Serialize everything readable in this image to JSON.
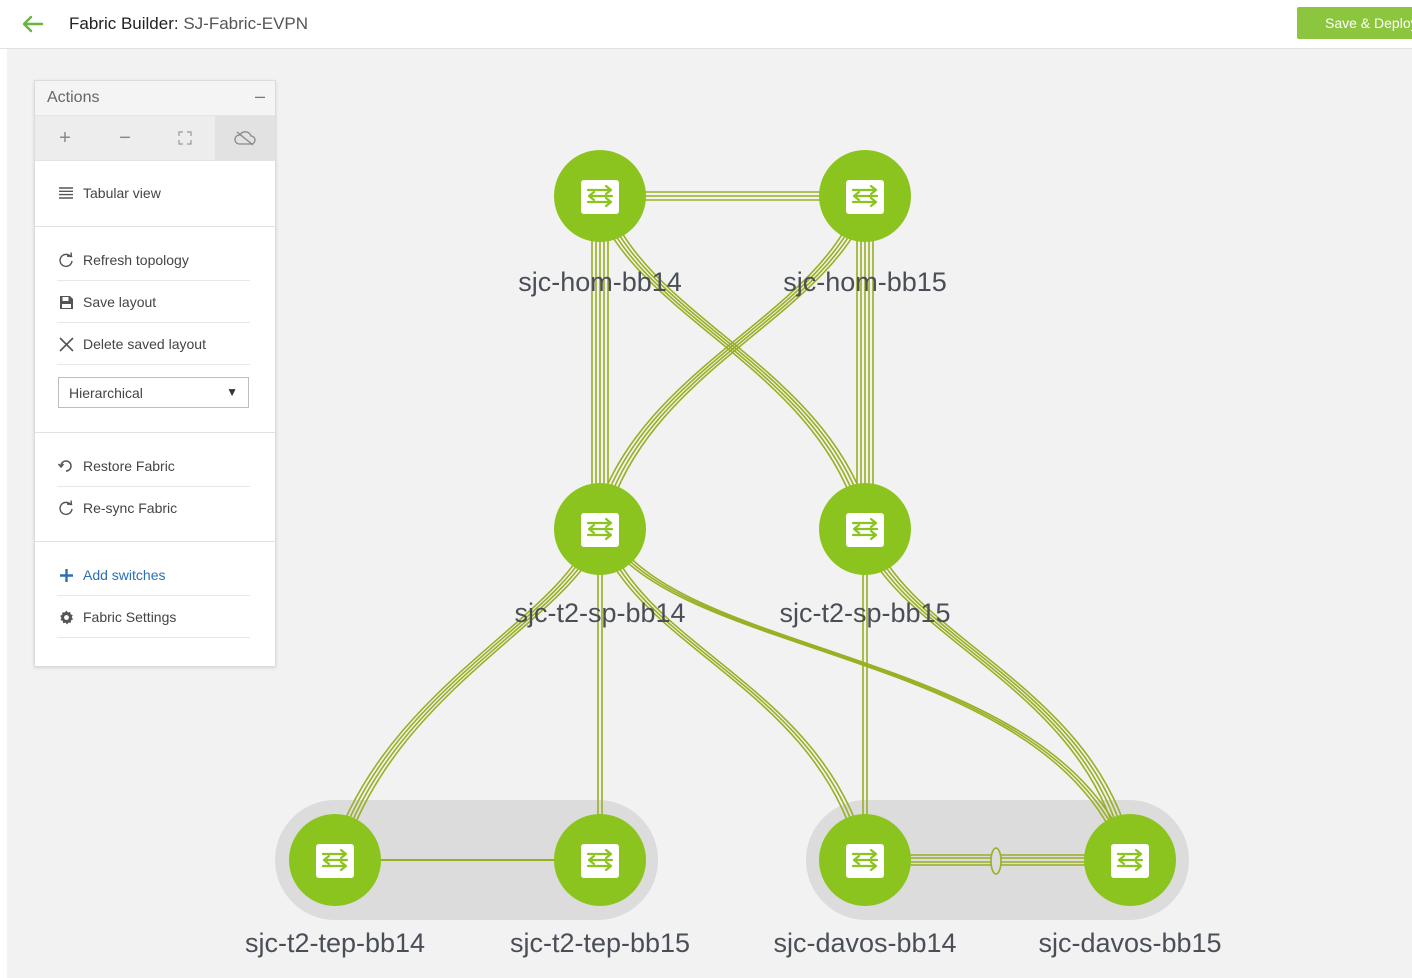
{
  "header": {
    "title_prefix": "Fabric Builder:",
    "title_name": "SJ-Fabric-EVPN",
    "save_label": "Save & Deploy"
  },
  "actions_panel": {
    "title": "Actions",
    "minimize": "–",
    "tools": [
      "zoom-in-icon",
      "zoom-out-icon",
      "fit-icon",
      "cloud-off-icon"
    ],
    "tabular_view": "Tabular view",
    "refresh_topology": "Refresh topology",
    "save_layout": "Save layout",
    "delete_saved_layout": "Delete saved layout",
    "layout_select": "Hierarchical",
    "restore_fabric": "Restore Fabric",
    "resync_fabric": "Re-sync Fabric",
    "add_switches": "Add switches",
    "fabric_settings": "Fabric Settings"
  },
  "topology": {
    "colors": {
      "node": "#8cc41f",
      "link": "#9aaf23",
      "group": "#dcdcdc",
      "label": "#4a4f57"
    },
    "nodes": [
      {
        "id": "hom14",
        "label": "sjc-hom-bb14"
      },
      {
        "id": "hom15",
        "label": "sjc-hom-bb15"
      },
      {
        "id": "sp14",
        "label": "sjc-t2-sp-bb14"
      },
      {
        "id": "sp15",
        "label": "sjc-t2-sp-bb15"
      },
      {
        "id": "tep14",
        "label": "sjc-t2-tep-bb14"
      },
      {
        "id": "tep15",
        "label": "sjc-t2-tep-bb15"
      },
      {
        "id": "davos14",
        "label": "sjc-davos-bb14"
      },
      {
        "id": "davos15",
        "label": "sjc-davos-bb15"
      }
    ]
  }
}
